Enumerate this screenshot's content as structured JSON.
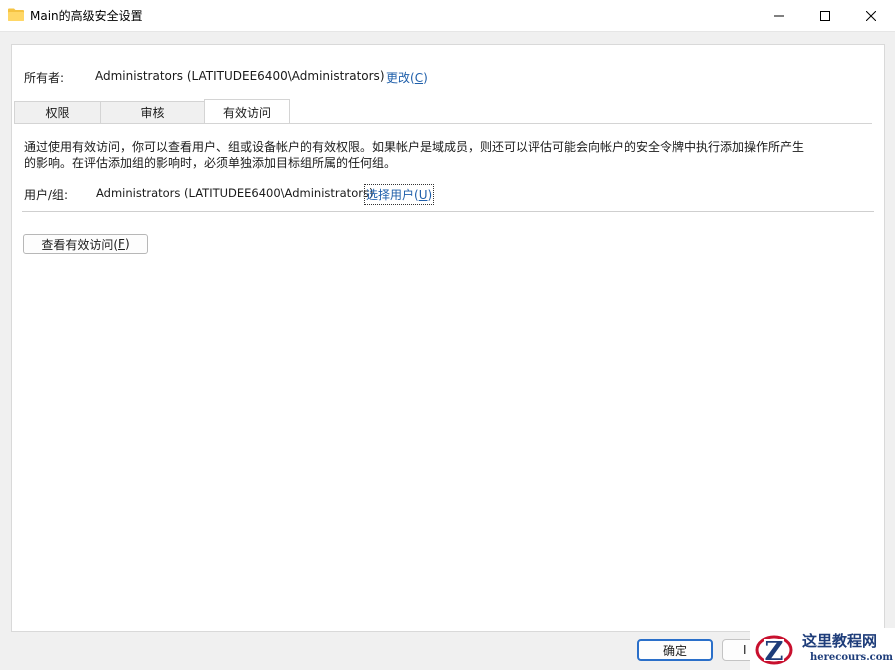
{
  "window": {
    "title": "Main的高级安全设置",
    "controls": {
      "minimize_icon": "minimize-icon",
      "maximize_icon": "maximize-icon",
      "close_icon": "close-icon"
    }
  },
  "owner": {
    "label": "所有者:",
    "value": "Administrators (LATITUDEE6400\\Administrators)",
    "change_prefix": "更改(",
    "change_key": "C",
    "change_suffix": ")"
  },
  "tabs": [
    {
      "label": "权限",
      "selected": false
    },
    {
      "label": "审核",
      "selected": false
    },
    {
      "label": "有效访问",
      "selected": true
    }
  ],
  "effective_access": {
    "description_line1": "通过使用有效访问，你可以查看用户、组或设备帐户的有效权限。如果帐户是域成员，则还可以评估可能会向帐户的安全令牌中执行添加操作所产生",
    "description_line2": "的影响。在评估添加组的影响时，必须单独添加目标组所属的任何组。",
    "user_label": "用户/组:",
    "user_value": "Administrators (LATITUDEE6400\\Administrators)",
    "select_user_prefix": "选择用户(",
    "select_user_key": "U",
    "select_user_suffix": ")",
    "view_button_prefix": "查看有效访问(",
    "view_button_key": "F",
    "view_button_suffix": ")"
  },
  "footer": {
    "ok_label": "确定",
    "cancel_label_partial": "I"
  },
  "watermark": {
    "title": "这里教程网",
    "subtitle": "herecours.com",
    "logo_letter": "Z"
  },
  "colors": {
    "link": "#1f5faa",
    "accent": "#2a6fc9",
    "folder": "#f5c342",
    "watermark": "#1e3d7a",
    "watermark_red": "#c8102e"
  }
}
